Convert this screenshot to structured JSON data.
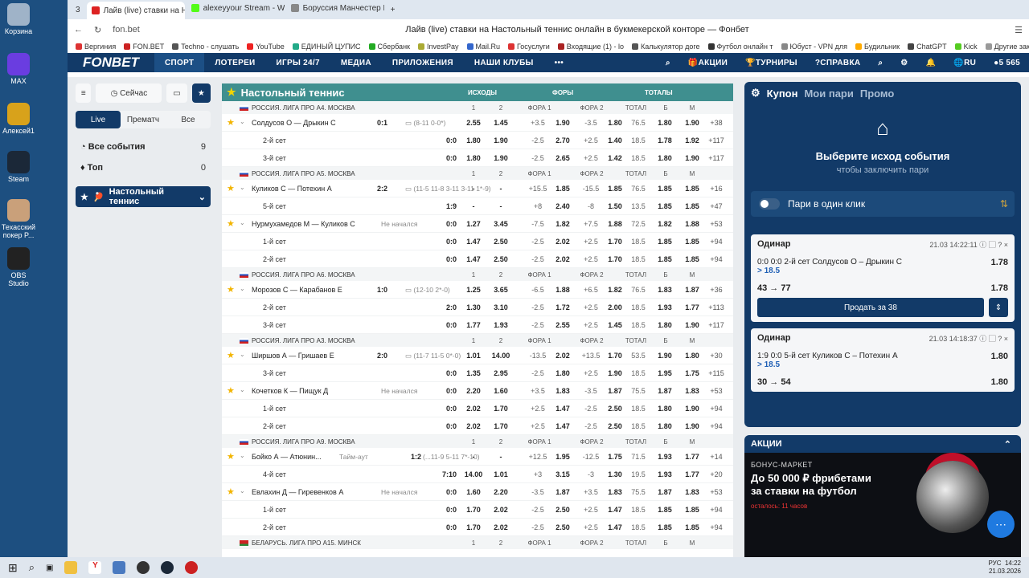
{
  "desktop": [
    {
      "label": "Корзина",
      "color": "#9fb3c8"
    },
    {
      "label": "MAX",
      "color": "#6a3de0"
    },
    {
      "label": "Алексей1",
      "color": "#d8a21b"
    },
    {
      "label": "Steam",
      "color": "#1b2838"
    },
    {
      "label": "Техасский покер P...",
      "color": "#c9a07a"
    },
    {
      "label": "OBS Studio",
      "color": "#222"
    }
  ],
  "browser": {
    "tabcount": "3",
    "tabs": [
      {
        "label": "Лайв (live) ставки на Н",
        "color": "#d22"
      },
      {
        "label": "alexeyyour Stream - Watc",
        "color": "#53fc18"
      },
      {
        "label": "Боруссия Манчестер Юна",
        "color": "#888"
      }
    ],
    "url": "fon.bet",
    "title": "Лайв (live) ставки на Настольный теннис онлайн в букмекерской конторе — Фонбет",
    "bookmarks": [
      "Вергиния",
      "FON.BET",
      "Techno - слушать",
      "YouTube",
      "ЕДИНЫЙ ЦУПИС",
      "Сбербанк",
      "InvestPay",
      "Mail.Ru",
      "Госуслуги",
      "Входящие (1) - lo",
      "Калькулятор доге",
      "Футбол онлайн т",
      "Юбуст - VPN для",
      "Будильник",
      "ChatGPT",
      "Kick",
      "Другие закладки"
    ]
  },
  "nav": {
    "logo": "FONBET",
    "items": [
      "СПОРТ",
      "ЛОТЕРЕИ",
      "ИГРЫ 24/7",
      "МЕДИА",
      "ПРИЛОЖЕНИЯ",
      "НАШИ КЛУБЫ",
      "•••"
    ],
    "right": [
      "АКЦИИ",
      "ТУРНИРЫ",
      "СПРАВКА",
      "RU",
      "5 565"
    ]
  },
  "left": {
    "now": "Сейчас",
    "seg": [
      "Live",
      "Прематч",
      "Все"
    ],
    "rows": [
      {
        "label": "Все события",
        "count": "9"
      },
      {
        "label": "Топ",
        "count": "0"
      }
    ],
    "sport": "Настольный теннис"
  },
  "table": {
    "sport": "Настольный теннис",
    "cols": [
      "ИСХОДЫ",
      "ФОРЫ",
      "ТОТАЛЫ"
    ],
    "hdr": [
      "1",
      "2",
      "ФОРА 1",
      "ФОРА 2",
      "ТОТАЛ",
      "Б",
      "М"
    ],
    "rows": [
      {
        "t": "lg",
        "name": "РОССИЯ. ЛИГА ПРО А4. МОСКВА"
      },
      {
        "t": "ev",
        "name": "Солдусов О — Дрыкин С",
        "info": "(8-11 0-0*)",
        "sc": "0:1",
        "v": [
          "2.55",
          "1.45",
          "+3.5",
          "1.90",
          "-3.5",
          "1.80",
          "76.5",
          "1.80",
          "1.90",
          "+38"
        ]
      },
      {
        "t": "sub",
        "name": "2-й сет",
        "sc": "0:0",
        "v": [
          "1.80",
          "1.90",
          "-2.5",
          "2.70",
          "+2.5",
          "1.40",
          "18.5",
          "1.78",
          "1.92",
          "+117"
        ]
      },
      {
        "t": "sub",
        "name": "3-й сет",
        "sc": "0:0",
        "v": [
          "1.80",
          "1.90",
          "-2.5",
          "2.65",
          "+2.5",
          "1.42",
          "18.5",
          "1.80",
          "1.90",
          "+117"
        ]
      },
      {
        "t": "lg",
        "name": "РОССИЯ. ЛИГА ПРО А5. МОСКВА"
      },
      {
        "t": "ev",
        "name": "Куликов С — Потехин А",
        "info": "(11-5 11-8 3-11 3-11 1*-9)",
        "sc": "2:2",
        "v": [
          "-",
          "-",
          "+15.5",
          "1.85",
          "-15.5",
          "1.85",
          "76.5",
          "1.85",
          "1.85",
          "+16"
        ]
      },
      {
        "t": "sub",
        "name": "5-й сет",
        "sc": "1:9",
        "v": [
          "-",
          "-",
          "+8",
          "2.40",
          "-8",
          "1.50",
          "13.5",
          "1.85",
          "1.85",
          "+47"
        ]
      },
      {
        "t": "ev",
        "name": "Нурмухамедов М — Куликов С",
        "info": "Не начался",
        "sc": "0:0",
        "v": [
          "1.27",
          "3.45",
          "-7.5",
          "1.82",
          "+7.5",
          "1.88",
          "72.5",
          "1.82",
          "1.88",
          "+53"
        ]
      },
      {
        "t": "sub",
        "name": "1-й сет",
        "sc": "0:0",
        "v": [
          "1.47",
          "2.50",
          "-2.5",
          "2.02",
          "+2.5",
          "1.70",
          "18.5",
          "1.85",
          "1.85",
          "+94"
        ]
      },
      {
        "t": "sub",
        "name": "2-й сет",
        "sc": "0:0",
        "v": [
          "1.47",
          "2.50",
          "-2.5",
          "2.02",
          "+2.5",
          "1.70",
          "18.5",
          "1.85",
          "1.85",
          "+94"
        ]
      },
      {
        "t": "lg",
        "name": "РОССИЯ. ЛИГА ПРО А6. МОСКВА"
      },
      {
        "t": "ev",
        "name": "Морозов С — Карабанов Е",
        "info": "(12-10 2*-0)",
        "sc": "1:0",
        "v": [
          "1.25",
          "3.65",
          "-6.5",
          "1.88",
          "+6.5",
          "1.82",
          "76.5",
          "1.83",
          "1.87",
          "+36"
        ]
      },
      {
        "t": "sub",
        "name": "2-й сет",
        "sc": "2:0",
        "v": [
          "1.30",
          "3.10",
          "-2.5",
          "1.72",
          "+2.5",
          "2.00",
          "18.5",
          "1.93",
          "1.77",
          "+113"
        ]
      },
      {
        "t": "sub",
        "name": "3-й сет",
        "sc": "0:0",
        "v": [
          "1.77",
          "1.93",
          "-2.5",
          "2.55",
          "+2.5",
          "1.45",
          "18.5",
          "1.80",
          "1.90",
          "+117"
        ]
      },
      {
        "t": "lg",
        "name": "РОССИЯ. ЛИГА ПРО А3. МОСКВА"
      },
      {
        "t": "ev",
        "name": "Ширшов А — Гришаев Е",
        "info": "(11-7 11-5 0*-0)",
        "sc": "2:0",
        "v": [
          "1.01",
          "14.00",
          "-13.5",
          "2.02",
          "+13.5",
          "1.70",
          "53.5",
          "1.90",
          "1.80",
          "+30"
        ]
      },
      {
        "t": "sub",
        "name": "3-й сет",
        "sc": "0:0",
        "v": [
          "1.35",
          "2.95",
          "-2.5",
          "1.80",
          "+2.5",
          "1.90",
          "18.5",
          "1.95",
          "1.75",
          "+115"
        ]
      },
      {
        "t": "ev",
        "name": "Кочетков К — Пищук Д",
        "info": "Не начался",
        "sc": "0:0",
        "v": [
          "2.20",
          "1.60",
          "+3.5",
          "1.83",
          "-3.5",
          "1.87",
          "75.5",
          "1.87",
          "1.83",
          "+53"
        ]
      },
      {
        "t": "sub",
        "name": "1-й сет",
        "sc": "0:0",
        "v": [
          "2.02",
          "1.70",
          "+2.5",
          "1.47",
          "-2.5",
          "2.50",
          "18.5",
          "1.80",
          "1.90",
          "+94"
        ]
      },
      {
        "t": "sub",
        "name": "2-й сет",
        "sc": "0:0",
        "v": [
          "2.02",
          "1.70",
          "+2.5",
          "1.47",
          "-2.5",
          "2.50",
          "18.5",
          "1.80",
          "1.90",
          "+94"
        ]
      },
      {
        "t": "lg",
        "name": "РОССИЯ. ЛИГА ПРО А9. МОСКВА"
      },
      {
        "t": "ev",
        "name": "Бойко А — Атюнин...",
        "info": "Тайм-аут",
        "sc": "1:2",
        "info2": "(...11-9 5-11 7*-10)",
        "v": [
          "-",
          "-",
          "+12.5",
          "1.95",
          "-12.5",
          "1.75",
          "71.5",
          "1.93",
          "1.77",
          "+14"
        ]
      },
      {
        "t": "sub",
        "name": "4-й сет",
        "sc": "7:10",
        "v": [
          "14.00",
          "1.01",
          "+3",
          "3.15",
          "-3",
          "1.30",
          "19.5",
          "1.93",
          "1.77",
          "+20"
        ]
      },
      {
        "t": "ev",
        "name": "Евлахин Д — Гиревенков А",
        "info": "Не начался",
        "sc": "0:0",
        "v": [
          "1.60",
          "2.20",
          "-3.5",
          "1.87",
          "+3.5",
          "1.83",
          "75.5",
          "1.87",
          "1.83",
          "+53"
        ]
      },
      {
        "t": "sub",
        "name": "1-й сет",
        "sc": "0:0",
        "v": [
          "1.70",
          "2.02",
          "-2.5",
          "2.50",
          "+2.5",
          "1.47",
          "18.5",
          "1.85",
          "1.85",
          "+94"
        ]
      },
      {
        "t": "sub",
        "name": "2-й сет",
        "sc": "0:0",
        "v": [
          "1.70",
          "2.02",
          "-2.5",
          "2.50",
          "+2.5",
          "1.47",
          "18.5",
          "1.85",
          "1.85",
          "+94"
        ]
      },
      {
        "t": "lg",
        "name": "БЕЛАРУСЬ. ЛИГА ПРО А15. МИНСК",
        "flag": "by"
      }
    ]
  },
  "coupon": {
    "tabs": [
      "Купон",
      "Мои пари",
      "Промо"
    ],
    "empty_title": "Выберите исход события",
    "empty_sub": "чтобы заключить пари",
    "oneclick": "Пари в один клик",
    "slips": [
      {
        "type": "Одинар",
        "time": "21.03  14:22:11",
        "score": "0:0",
        "desc": "0:0 2-й сет Солдусов О – Дрыкин С",
        "outcome": "> 18.5",
        "odd": "1.78",
        "change": "43 → 77",
        "odd2": "1.78",
        "sell": "Продать за 38"
      },
      {
        "type": "Одинар",
        "time": "21.03  14:18:37",
        "score": "1:9",
        "desc": "0:0 5-й сет Куликов С – Потехин А",
        "outcome": "> 18.5",
        "odd": "1.80",
        "change": "30 → 54",
        "odd2": "1.80"
      }
    ]
  },
  "promo": {
    "header": "АКЦИИ",
    "tag": "БОНУС-МАРКЕТ",
    "title": "До 50 000 ₽ фрибетами за ставки на футбол",
    "remain": "осталось: 11 часов"
  },
  "clock": {
    "time": "14:22",
    "date": "21.03.2026",
    "lang": "РУС"
  }
}
